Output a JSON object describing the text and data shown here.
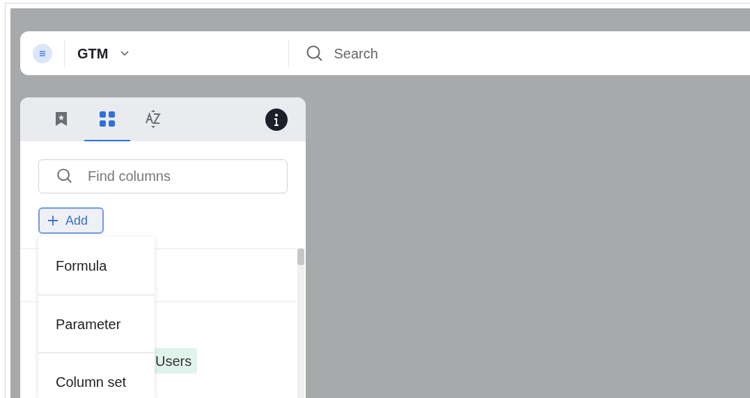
{
  "topbar": {
    "title": "GTM",
    "search": {
      "placeholder": "Search"
    }
  },
  "panel": {
    "tabs": [
      {
        "kind": "bookmark",
        "selected": false
      },
      {
        "kind": "grid",
        "selected": true
      },
      {
        "kind": "az",
        "selected": false
      }
    ],
    "find": {
      "placeholder": "Find columns"
    },
    "add_button": {
      "label": "Add"
    },
    "list": [
      {
        "tag": "Users"
      }
    ],
    "menu": [
      {
        "label": "Formula"
      },
      {
        "label": "Parameter"
      },
      {
        "label": "Column set"
      }
    ]
  }
}
